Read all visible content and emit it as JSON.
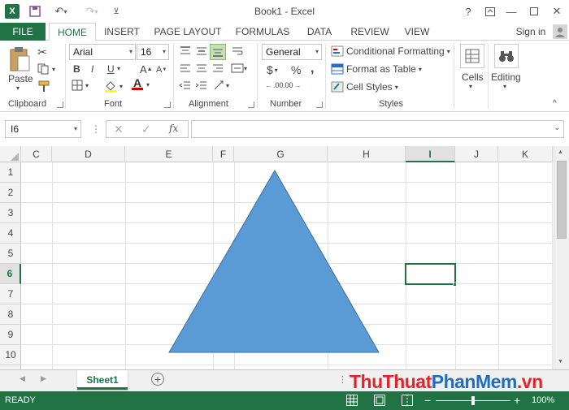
{
  "window": {
    "title": "Book1 - Excel",
    "help": "?",
    "colors": {
      "accent": "#217346",
      "shape": "#5b9bd5",
      "shape_border": "#41719c"
    }
  },
  "tabs": [
    {
      "label": "FILE"
    },
    {
      "label": "HOME"
    },
    {
      "label": "INSERT"
    },
    {
      "label": "PAGE LAYOUT"
    },
    {
      "label": "FORMULAS"
    },
    {
      "label": "DATA"
    },
    {
      "label": "REVIEW"
    },
    {
      "label": "VIEW"
    }
  ],
  "signin": "Sign in",
  "ribbon": {
    "clipboard": {
      "label": "Clipboard",
      "paste": "Paste"
    },
    "font": {
      "label": "Font",
      "name": "Arial",
      "size": "16",
      "bold": "B",
      "italic": "I",
      "underline": "U",
      "grow": "A",
      "shrink": "A",
      "color_a": "A"
    },
    "alignment": {
      "label": "Alignment"
    },
    "number": {
      "label": "Number",
      "format": "General",
      "currency": "$",
      "percent": "%",
      "comma": ",",
      "inc_dec": ".00",
      "dec_dec": ".00"
    },
    "styles": {
      "label": "Styles",
      "conditional": "Conditional Formatting",
      "format_table": "Format as Table",
      "cell_styles": "Cell Styles"
    },
    "cells": {
      "label": "Cells"
    },
    "editing": {
      "label": "Editing"
    }
  },
  "formula_bar": {
    "name_box": "I6",
    "fx": "fx",
    "value": ""
  },
  "columns": [
    "C",
    "D",
    "E",
    "F",
    "G",
    "H",
    "I",
    "J",
    "K"
  ],
  "rows": [
    "1",
    "2",
    "3",
    "4",
    "5",
    "6",
    "7",
    "8",
    "9",
    "10"
  ],
  "selected": {
    "column": "I",
    "row": "6"
  },
  "sheet": {
    "tab": "Sheet1"
  },
  "status": {
    "ready": "READY",
    "zoom": "100%"
  },
  "watermark": {
    "part1": "ThuThuat",
    "part2": "PhanMem",
    "part3": ".vn"
  }
}
